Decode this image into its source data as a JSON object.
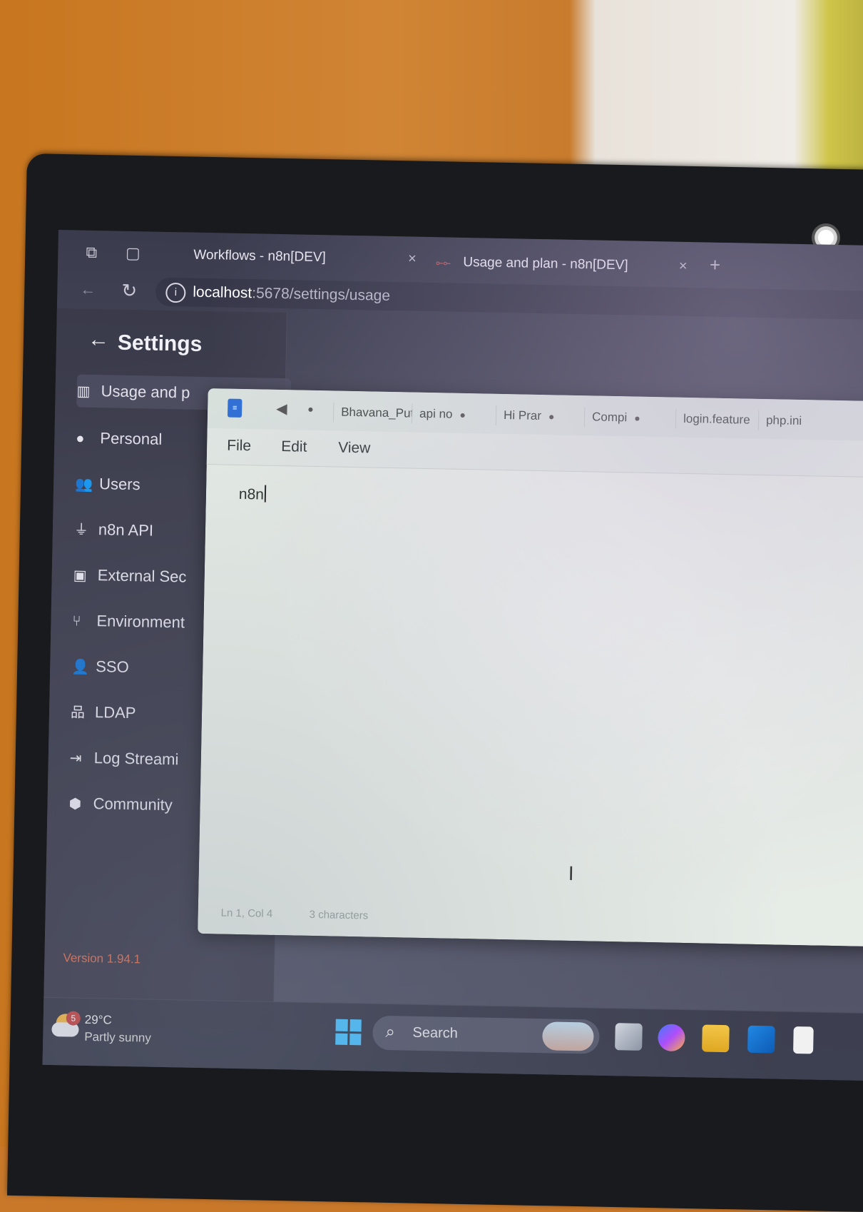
{
  "browser": {
    "tabs": [
      {
        "title": "Workflows - n8n[DEV]",
        "close": "×"
      },
      {
        "title": "Usage and plan - n8n[DEV]",
        "close": "×"
      }
    ],
    "new_tab": "+",
    "url_host": "localhost",
    "url_path": ":5678/settings/usage"
  },
  "settings": {
    "title": "Settings",
    "back": "←",
    "nav": [
      {
        "label": "Usage and p",
        "icon": "bar-chart-icon",
        "glyph": "▥",
        "active": true
      },
      {
        "label": "Personal",
        "icon": "user-circle-icon",
        "glyph": "●",
        "active": false
      },
      {
        "label": "Users",
        "icon": "users-icon",
        "glyph": "👥",
        "active": false
      },
      {
        "label": "n8n API",
        "icon": "plug-icon",
        "glyph": "⏚",
        "active": false
      },
      {
        "label": "External Sec",
        "icon": "vault-icon",
        "glyph": "▣",
        "active": false
      },
      {
        "label": "Environment",
        "icon": "git-branch-icon",
        "glyph": "⑂",
        "active": false
      },
      {
        "label": "SSO",
        "icon": "user-lock-icon",
        "glyph": "👤",
        "active": false
      },
      {
        "label": "LDAP",
        "icon": "network-icon",
        "glyph": "品",
        "active": false
      },
      {
        "label": "Log Streami",
        "icon": "sign-in-icon",
        "glyph": "⇥",
        "active": false
      },
      {
        "label": "Community",
        "icon": "cube-icon",
        "glyph": "⬢",
        "active": false
      }
    ],
    "version": "Version 1.94.1"
  },
  "notepad": {
    "tabs": [
      "Bhavana_Put",
      "api no",
      "Hi Prar",
      "Compi",
      "login.feature",
      "php.ini"
    ],
    "menu": [
      "File",
      "Edit",
      "View"
    ],
    "content": "n8n",
    "status_position": "Ln 1, Col 4",
    "status_chars": "3 characters"
  },
  "taskbar": {
    "weather_badge": "5",
    "temperature": "29°C",
    "condition": "Partly sunny",
    "search_label": "Search"
  }
}
